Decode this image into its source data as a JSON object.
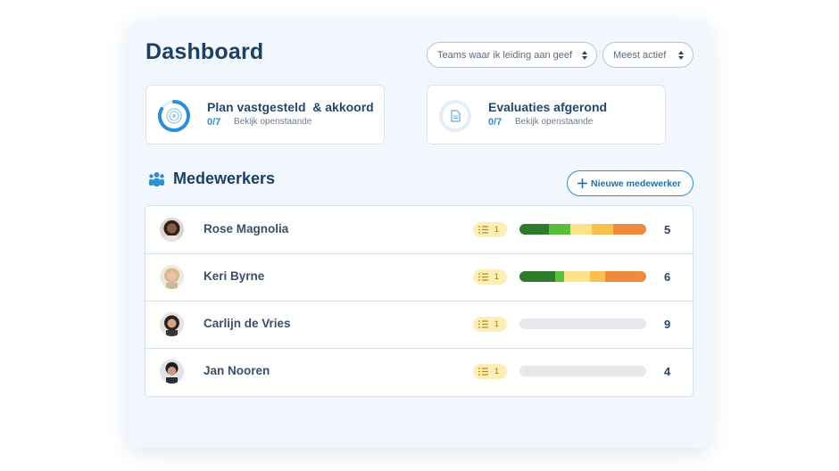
{
  "header": {
    "title": "Dashboard",
    "team_filter": "Teams waar ik leiding aan geef",
    "sort_filter": "Meest actief"
  },
  "cards": [
    {
      "title": "Plan vastgesteld  & akkoord",
      "count": "0/7",
      "link": "Bekijk openstaande",
      "icon": "target-progress-icon"
    },
    {
      "title": "Evaluaties afgerond",
      "count": "0/7",
      "link": "Bekijk openstaande",
      "icon": "document-icon"
    }
  ],
  "team_section": {
    "title": "Medewerkers",
    "icon": "people-group-icon",
    "add_button": "Nieuwe medewerker"
  },
  "employees": [
    {
      "name": "Rose Magnolia",
      "tasks": "1",
      "score": "5",
      "progress": [
        0.23,
        0.17,
        0.17,
        0.17,
        0.26
      ]
    },
    {
      "name": "Keri Byrne",
      "tasks": "1",
      "score": "6",
      "progress": [
        0.31,
        0.08,
        0.22,
        0.13,
        0.36
      ]
    },
    {
      "name": "Carlijn de Vries",
      "tasks": "1",
      "score": "9",
      "progress": []
    },
    {
      "name": "Jan Nooren",
      "tasks": "1",
      "score": "4",
      "progress": []
    }
  ],
  "colors": {
    "accent": "#2a8fd6",
    "title": "#1d3f62",
    "progress_segments": [
      "#2f7a2b",
      "#5bbd3c",
      "#fde28a",
      "#fbc04c",
      "#ef8a3c"
    ],
    "progress_empty": "#e5e9ee",
    "task_badge": "#fdeeb8"
  }
}
